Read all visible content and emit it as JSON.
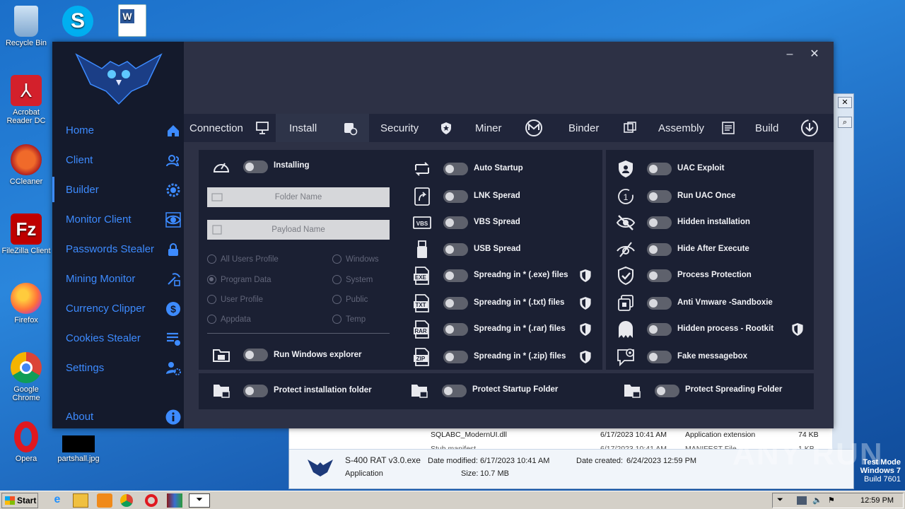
{
  "desktop": {
    "icons": [
      {
        "label": "Recycle Bin",
        "icon": "recycle-bin-icon"
      },
      {
        "label": "",
        "icon": "skype-icon"
      },
      {
        "label": "",
        "icon": "word-document-icon"
      },
      {
        "label": "Acrobat Reader DC",
        "icon": "acrobat-icon"
      },
      {
        "label": "CCleaner",
        "icon": "ccleaner-icon"
      },
      {
        "label": "FileZilla Client",
        "icon": "filezilla-icon"
      },
      {
        "label": "Firefox",
        "icon": "firefox-icon"
      },
      {
        "label": "Google Chrome",
        "icon": "chrome-icon"
      },
      {
        "label": "Opera",
        "icon": "opera-icon"
      },
      {
        "label": "partshall.jpg",
        "icon": "image-file-icon"
      }
    ]
  },
  "explorer": {
    "rows": [
      {
        "name": "SQLABC_ModernUI.dll",
        "date": "6/17/2023 10:41 AM",
        "type": "Application extension",
        "size": "74 KB"
      },
      {
        "name": "Stub.manifest",
        "date": "6/17/2023 10:41 AM",
        "type": "MANIFEST File",
        "size": "1 KB"
      }
    ],
    "details": {
      "filename": "S-400 RAT v3.0.exe",
      "modified_label": "Date modified:",
      "modified": "6/17/2023 10:41 AM",
      "created_label": "Date created:",
      "created": "6/24/2023 12:59 PM",
      "type": "Application",
      "size_label": "Size:",
      "size": "10.7 MB"
    }
  },
  "app": {
    "minimize": "–",
    "close": "✕",
    "sidebar": [
      {
        "label": "Home",
        "icon": "home-icon"
      },
      {
        "label": "Client",
        "icon": "users-icon"
      },
      {
        "label": "Builder",
        "icon": "gear-icon"
      },
      {
        "label": "Monitor Client",
        "icon": "eye-icon"
      },
      {
        "label": "Passwords Stealer",
        "icon": "lock-icon"
      },
      {
        "label": "Mining Monitor",
        "icon": "pickaxe-icon"
      },
      {
        "label": "Currency Clipper",
        "icon": "dollar-icon"
      },
      {
        "label": "Cookies Stealer",
        "icon": "list-icon"
      },
      {
        "label": "Settings",
        "icon": "user-settings-icon"
      },
      {
        "label": "About",
        "icon": "info-icon"
      }
    ],
    "tabs": [
      {
        "label": "Connection",
        "icon": "monitor-icon"
      },
      {
        "label": "Install",
        "icon": "install-icon"
      },
      {
        "label": "Security",
        "icon": "shield-icon"
      },
      {
        "label": "Miner",
        "icon": "monero-icon"
      },
      {
        "label": "Binder",
        "icon": "binder-icon"
      },
      {
        "label": "Assembly",
        "icon": "assembly-icon"
      },
      {
        "label": "Build",
        "icon": "download-icon"
      }
    ],
    "install": {
      "installing": "Installing",
      "folder_name_placeholder": "Folder Name",
      "payload_name_placeholder": "Payload Name",
      "radios": [
        {
          "label": "All Users Profile",
          "checked": false
        },
        {
          "label": "Windows",
          "checked": false
        },
        {
          "label": "Program Data",
          "checked": true
        },
        {
          "label": "System",
          "checked": false
        },
        {
          "label": "User Profile",
          "checked": false
        },
        {
          "label": "Public",
          "checked": false
        },
        {
          "label": "Appdata",
          "checked": false
        },
        {
          "label": "Temp",
          "checked": false
        }
      ],
      "run_explorer": "Run  Windows explorer"
    },
    "spread_options": [
      "Auto Startup",
      "LNK Sperad",
      "VBS Spread",
      "USB Spread",
      "Spreadng in * (.exe) files",
      "Spreadng in * (.txt) files",
      "Spreadng in * (.rar) files",
      "Spreadng in * (.zip) files"
    ],
    "security_options": [
      "UAC Exploit",
      "Run UAC Once",
      "Hidden installation",
      "Hide After Execute",
      "Process Protection",
      "Anti Vmware -Sandboxie",
      "Hidden process - Rootkit",
      "Fake messagebox"
    ],
    "bottom": {
      "protect_install": "Protect installation folder",
      "protect_startup": "Protect Startup Folder",
      "protect_spreading": "Protect Spreading Folder"
    },
    "colors": {
      "accent": "#3d8bff",
      "sidebar_bg": "#141a2c",
      "panel_bg": "#1b2033",
      "main_bg": "#2d3145"
    }
  },
  "taskbar": {
    "start": "Start",
    "clock": "12:59 PM"
  },
  "watermark": "ANY RUN",
  "testmode": {
    "line1": "Test Mode",
    "line2": "Windows 7",
    "line3": "Build 7601"
  }
}
